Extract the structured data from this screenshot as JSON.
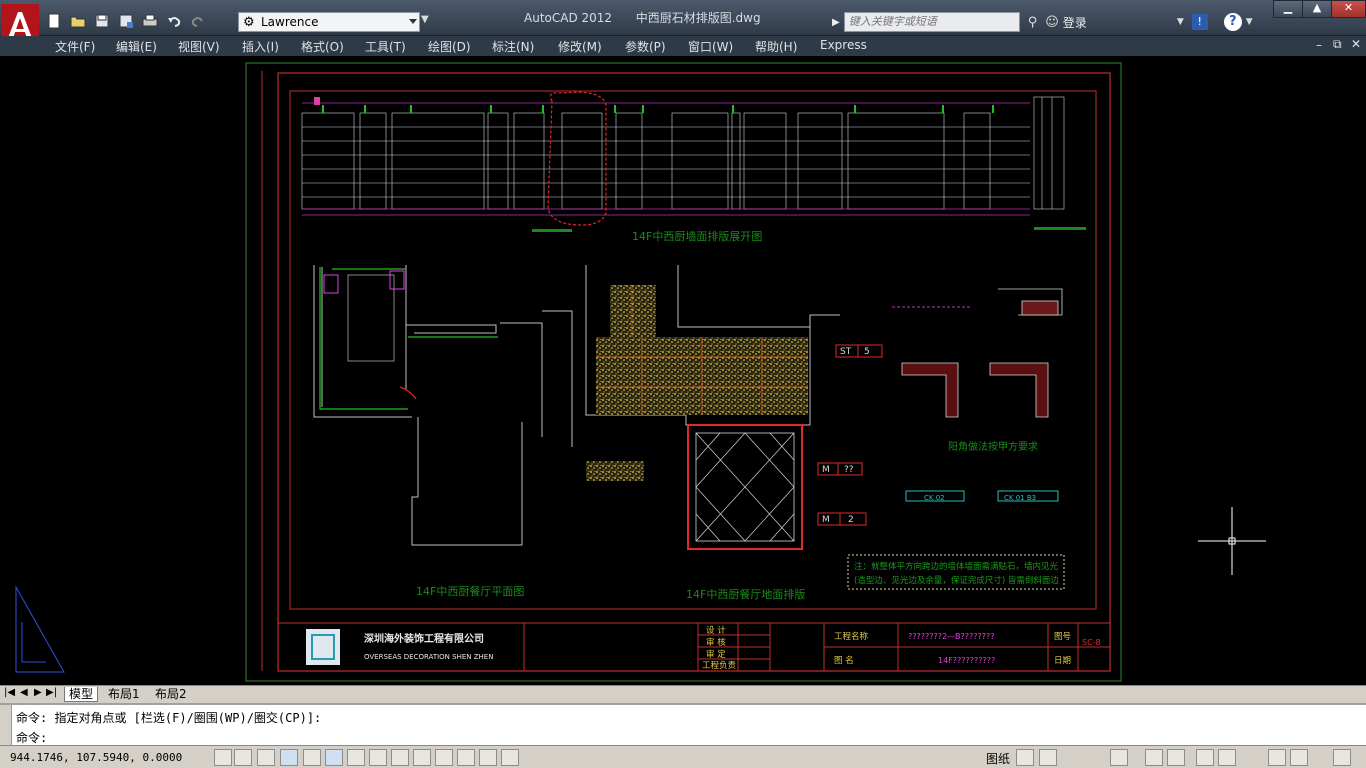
{
  "window": {
    "app_name": "AutoCAD 2012",
    "file_name": "中西厨石材排版图.dwg",
    "workspace": "Lawrence",
    "search_placeholder": "键入关键字或短语",
    "login_label": "登录"
  },
  "menu": [
    "文件(F)",
    "编辑(E)",
    "视图(V)",
    "插入(I)",
    "格式(O)",
    "工具(T)",
    "绘图(D)",
    "标注(N)",
    "修改(M)",
    "参数(P)",
    "窗口(W)",
    "帮助(H)",
    "Express"
  ],
  "drawing": {
    "elevation_title": "14F中西厨墙面排版展开图",
    "plan_title": "14F中西厨餐厅平面图",
    "floor_title": "14F中西厨餐厅地面排版",
    "detail_caption": "阳角做法按甲方要求",
    "tag_st": "ST",
    "tag_st_no": "5",
    "tag_m1": "M",
    "tag_m1_no": "??",
    "tag_m2": "M",
    "tag_m2_no": "2",
    "note_line1": "注：就整体平方向跨边的墙体墙面需满贴石，墙内见光",
    "note_line2": "(造型边、见光边及余量，保证完成尺寸) 皆需倒斜面边",
    "company_cn": "深圳海外装饰工程有限公司",
    "company_en": "OVERSEAS DECORATION SHEN ZHEN",
    "tb_design": "设  计",
    "tb_check": "审  核",
    "tb_approve": "审  定",
    "tb_pm": "工程负责",
    "tb_project_label": "工程名称",
    "tb_project_value": "????????2—B????????",
    "tb_name_label": "图    名",
    "tb_name_value": "14F??????????",
    "tb_no_label": "图号",
    "tb_date_label": "日期",
    "tb_no_value": "SC-8",
    "wall_tag1": "CK 02",
    "wall_tag2": "CK 01 B3"
  },
  "layout_tabs": [
    "模型",
    "布局1",
    "布局2"
  ],
  "command": {
    "history": "命令: 指定对角点或 [栏选(F)/圈围(WP)/圈交(CP)]:",
    "prompt": "命令:"
  },
  "status": {
    "coords": "944.1746, 107.5940, 0.0000",
    "paper_label": "图纸"
  }
}
